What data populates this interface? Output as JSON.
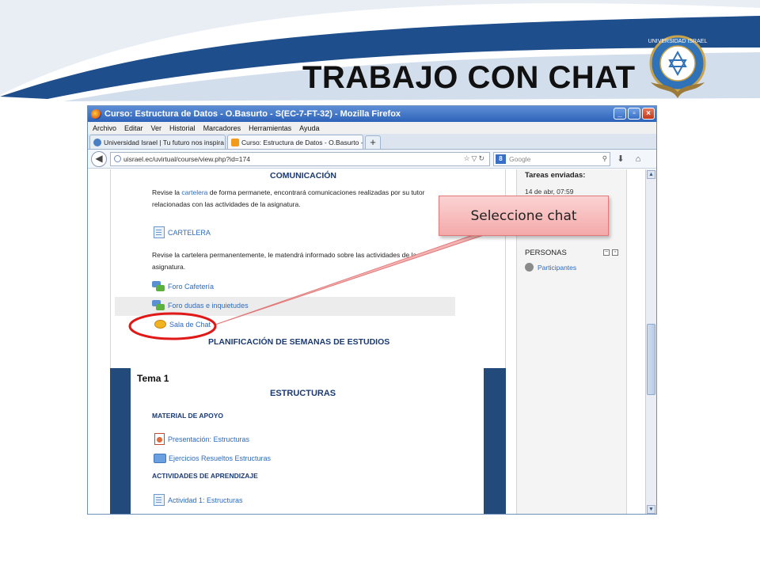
{
  "slide": {
    "title": "TRABAJO CON CHAT",
    "callout": "Seleccione chat"
  },
  "colors": {
    "swoosh_blue": "#1f4e8c",
    "moodle_band": "#224a7a",
    "link_blue": "#2c6bbf",
    "callout_fill": "#f4a9a9",
    "highlight_red": "#e01818"
  },
  "browser": {
    "window_title": "Curso: Estructura de Datos - O.Basurto - S(EC-7-FT-32) - Mozilla Firefox",
    "menu": [
      "Archivo",
      "Editar",
      "Ver",
      "Historial",
      "Marcadores",
      "Herramientas",
      "Ayuda"
    ],
    "tabs": [
      {
        "label": "Universidad Israel | Tu futuro nos inspira",
        "close": "×"
      },
      {
        "label": "Curso: Estructura de Datos - O.Basurto -...",
        "close": "×"
      }
    ],
    "new_tab": "+",
    "url": "uisrael.ec/uvirtual/course/view.php?id=174",
    "search_engine": "Google",
    "icons": [
      "back-arrow-icon",
      "globe-icon",
      "star-icon",
      "reload-icon",
      "google-icon",
      "search-icon",
      "download-icon",
      "home-icon"
    ]
  },
  "course": {
    "comunicacion": {
      "title": "COMUNICACIÓN",
      "intro_before": "Revise la ",
      "intro_link": "cartelera",
      "intro_after": " de forma permanete, encontrará comunicaciones realizadas por su tutor",
      "intro_line2": "relacionadas con las actividades de la asignatura.",
      "cartelera": "CARTELERA",
      "text2_line1": "Revise la cartelera permanentemente, le matendrá informado sobre las actividades de la",
      "text2_line2": "asignatura.",
      "foro_cafeteria": "Foro Cafetería",
      "foro_dudas": "Foro dudas e inquietudes",
      "sala_chat": "Sala de Chat"
    },
    "planificacion": "PLANIFICACIÓN DE SEMANAS DE ESTUDIOS",
    "tema": {
      "title": "Tema 1",
      "heading": "ESTRUCTURAS",
      "material": "MATERIAL DE APOYO",
      "presentacion": "Presentación: Estructuras",
      "ejercicios": "Ejercicios Resueltos Estructuras",
      "actividades": "ACTIVIDADES DE APRENDIZAJE",
      "actividad1": "Actividad 1: Estructuras"
    }
  },
  "sidebar": {
    "tareas": "Tareas enviadas:",
    "tareas_date": "14 de abr, 07:59",
    "personas": "PERSONAS",
    "participantes": "Participantes",
    "ctrl_minus": "−",
    "ctrl_dock": "▫"
  },
  "scroll": {
    "up": "▲",
    "down": "▼"
  }
}
